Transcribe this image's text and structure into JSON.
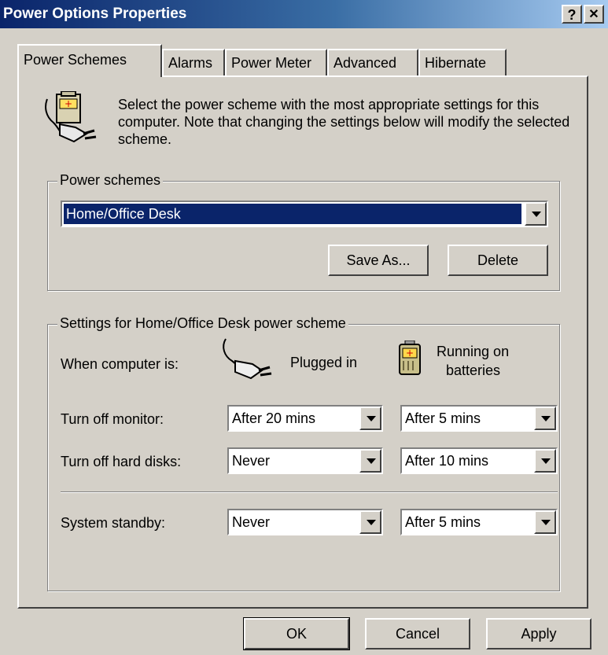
{
  "window": {
    "title": "Power Options Properties",
    "help_label": "?",
    "close_label": "✕"
  },
  "tabs": [
    {
      "label": "Power Schemes",
      "active": true
    },
    {
      "label": "Alarms"
    },
    {
      "label": "Power Meter"
    },
    {
      "label": "Advanced"
    },
    {
      "label": "Hibernate"
    }
  ],
  "intro": {
    "text": "Select the power scheme with the most appropriate settings for this computer. Note that changing the settings below will modify the selected scheme."
  },
  "power_schemes": {
    "legend": "Power schemes",
    "selected": "Home/Office Desk",
    "save_as_label": "Save As...",
    "delete_label": "Delete"
  },
  "settings": {
    "legend": "Settings for Home/Office Desk power scheme",
    "when_label": "When computer is:",
    "plugged_label": "Plugged in",
    "battery_label_line1": "Running on",
    "battery_label_line2": "batteries",
    "rows": [
      {
        "label": "Turn off monitor:",
        "plugged": "After 20 mins",
        "battery": "After 5 mins"
      },
      {
        "label": "Turn off hard disks:",
        "plugged": "Never",
        "battery": "After 10 mins"
      },
      {
        "label": "System standby:",
        "plugged": "Never",
        "battery": "After 5 mins"
      }
    ]
  },
  "footer": {
    "ok_label": "OK",
    "cancel_label": "Cancel",
    "apply_label": "Apply"
  },
  "colors": {
    "titlebar_start": "#0a246a",
    "titlebar_end": "#a6caf0",
    "face": "#d4d0c8",
    "selection": "#0a246a"
  }
}
